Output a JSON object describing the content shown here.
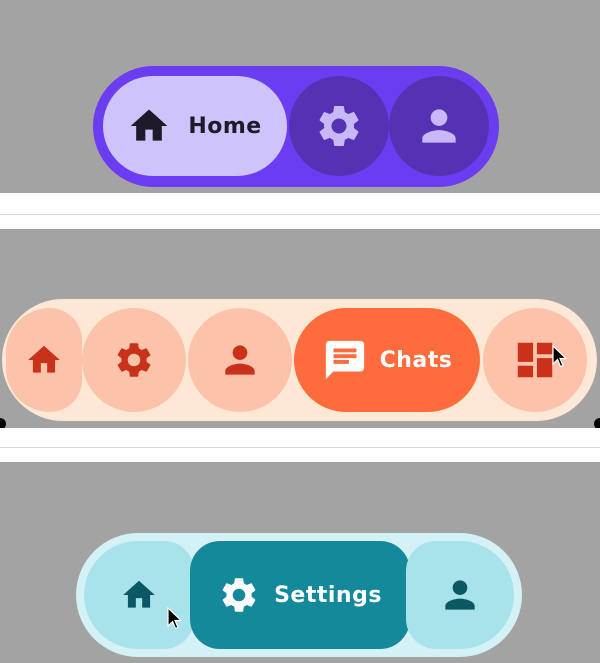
{
  "nav_purple": {
    "colors": {
      "bar": "#6a3df0",
      "active_pill": "#cfc3fb",
      "inactive_circle": "#5532b3",
      "active_fg": "#1e1a2a",
      "inactive_fg": "#c9b8f7"
    },
    "items": [
      {
        "label": "Home",
        "icon": "home-icon",
        "active": true
      },
      {
        "label": "",
        "icon": "gear-icon",
        "active": false
      },
      {
        "label": "",
        "icon": "person-icon",
        "active": false
      }
    ]
  },
  "nav_orange": {
    "colors": {
      "bar": "#fde8d6",
      "active_pill": "#fe6b3c",
      "inactive_circle": "#fcc2aa",
      "inactive_fg": "#c8321a",
      "active_fg": "#ffffff"
    },
    "items": [
      {
        "label": "",
        "icon": "home-icon",
        "active": false
      },
      {
        "label": "",
        "icon": "gear-icon",
        "active": false
      },
      {
        "label": "",
        "icon": "person-icon",
        "active": false
      },
      {
        "label": "Chats",
        "icon": "chat-icon",
        "active": true
      },
      {
        "label": "",
        "icon": "dashboard-icon",
        "active": false
      }
    ]
  },
  "nav_teal": {
    "colors": {
      "bar": "#d4f1f5",
      "active_pill": "#13899a",
      "inactive_circle": "#a8e3ec",
      "inactive_fg": "#0c5764",
      "active_fg": "#ffffff"
    },
    "items": [
      {
        "label": "",
        "icon": "home-icon",
        "active": false
      },
      {
        "label": "Settings",
        "icon": "gear-icon",
        "active": true
      },
      {
        "label": "",
        "icon": "person-icon",
        "active": false
      }
    ]
  }
}
